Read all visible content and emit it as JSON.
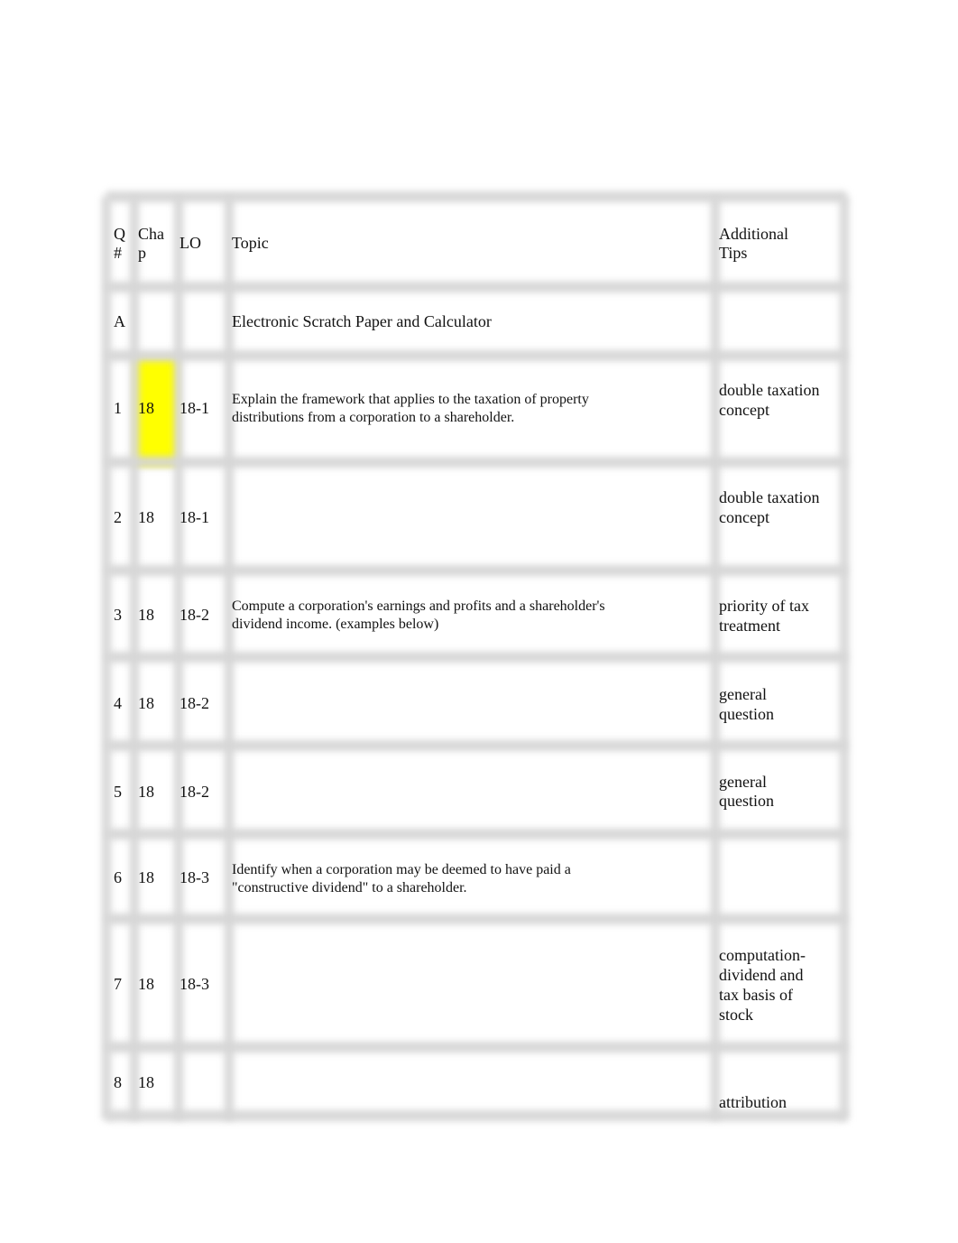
{
  "table": {
    "headers": {
      "q": "Q #",
      "chap": "Cha p",
      "lo": "LO",
      "topic": "Topic",
      "tips": "Additional Tips"
    },
    "header_lines": {
      "q": [
        "Q",
        "#"
      ],
      "chap": [
        "Cha",
        "p"
      ],
      "tips": [
        "Additional",
        "Tips"
      ]
    },
    "highlight_color": "#ffff00",
    "rows": [
      {
        "q": "A",
        "chap": "",
        "lo": "",
        "topic": "Electronic Scratch Paper and Calculator",
        "tips": ""
      },
      {
        "q": "1",
        "chap": "18",
        "lo": "18-1",
        "topic": "Explain the framework that applies to the taxation of property distributions from a corporation to a shareholder.",
        "tips": "double taxation concept",
        "highlighted": "chap"
      },
      {
        "q": "2",
        "chap": "18",
        "lo": "18-1",
        "topic": "",
        "tips": "double taxation concept"
      },
      {
        "q": "3",
        "chap": "18",
        "lo": "18-2",
        "topic": "Compute a corporation's earnings and profits and a shareholder's dividend income. (examples below)",
        "tips": "priority of tax treatment"
      },
      {
        "q": "4",
        "chap": "18",
        "lo": "18-2",
        "topic": "",
        "tips": "general question"
      },
      {
        "q": "5",
        "chap": "18",
        "lo": "18-2",
        "topic": "",
        "tips": "general question"
      },
      {
        "q": "6",
        "chap": "18",
        "lo": "18-3",
        "topic": "Identify when a corporation may be deemed to have paid a \"constructive dividend\" to a shareholder.",
        "tips": ""
      },
      {
        "q": "7",
        "chap": "18",
        "lo": "18-3",
        "topic": "",
        "tips": "computation-dividend and tax basis of stock"
      },
      {
        "q": "8",
        "chap": "18",
        "lo": "",
        "topic": "",
        "tips": "attribution"
      }
    ]
  }
}
